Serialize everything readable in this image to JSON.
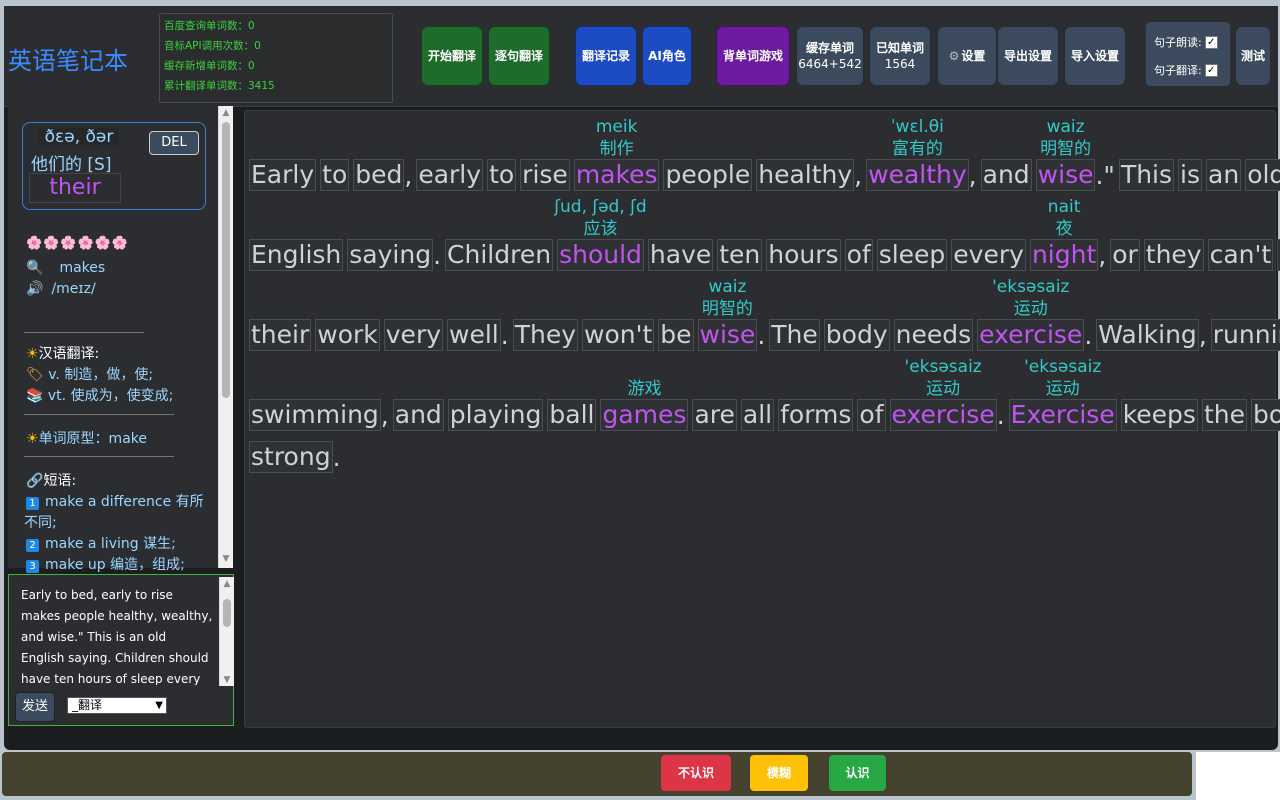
{
  "app_title": "英语笔记本",
  "stats": [
    "百度查询单词数：0",
    "音标API调用次数：0",
    "缓存新增单词数：0",
    "累计翻译单词数：3415"
  ],
  "toolbar": {
    "start_translate": "开始翻译",
    "sentence_translate": "逐句翻译",
    "history": "翻译记录",
    "ai_role": "AI角色",
    "word_game": "背单词游戏",
    "cached_label": "缓存单词",
    "cached_count": "6464+542",
    "known_label": "已知单词",
    "known_count": "1564",
    "settings": "设置",
    "export": "导出设置",
    "import": "导入设置",
    "read_sentence": "句子朗读:",
    "translate_sentence": "句子翻译:",
    "test": "测试"
  },
  "word_card": {
    "phonetic": "ðɛə, ðər",
    "meaning": "他们的 [S]",
    "word": "their",
    "delete": "DEL"
  },
  "details": {
    "rating": "🌸🌸🌸🌸🌸🌸",
    "lookup_word": "makes",
    "phonetic": "/meɪz/",
    "translation_header": "汉语翻译:",
    "def1": "v. 制造，做，使;",
    "def2": "vt. 使成为，使变成;",
    "base_form": "单词原型：make",
    "phrase_header": "短语:",
    "phrase1a": "make a difference 有所",
    "phrase1b": "不同;",
    "phrase2": "make a living 谋生;",
    "phrase3": "make up 编造，组成;"
  },
  "chat": {
    "text": "Early to bed, early to rise makes people healthy, wealthy, and wise.\" This is an old English saying. Children should have ten hours of sleep every night,",
    "send": "发送",
    "mode": "_翻译"
  },
  "passage": {
    "line1": [
      {
        "t": "Early"
      },
      {
        "t": "to"
      },
      {
        "t": "bed"
      },
      {
        "p": ","
      },
      {
        "t": "early"
      },
      {
        "t": "to"
      },
      {
        "t": "rise"
      },
      {
        "t": "makes",
        "hl": true,
        "ph": "meik",
        "cn": "制作"
      },
      {
        "t": "people"
      },
      {
        "t": "healthy"
      },
      {
        "p": ","
      },
      {
        "t": "wealthy",
        "hl": true,
        "ph": "ˈwɛl.θi",
        "cn": "富有的"
      },
      {
        "p": ","
      },
      {
        "t": "and"
      },
      {
        "t": "wise",
        "hl": true,
        "ph": "waiz",
        "cn": "明智的"
      },
      {
        "p": ".\""
      },
      {
        "t": "This"
      },
      {
        "t": "is"
      },
      {
        "t": "an"
      },
      {
        "t": "old"
      }
    ],
    "line2": [
      {
        "t": "English"
      },
      {
        "t": "saying"
      },
      {
        "p": "."
      },
      {
        "t": "Children"
      },
      {
        "t": " should ",
        "hl": true,
        "ph": "ʃud, ʃəd, ʃd",
        "cn": "应该"
      },
      {
        "t": "have"
      },
      {
        "t": "ten"
      },
      {
        "t": "hours"
      },
      {
        "t": "of"
      },
      {
        "t": "sleep"
      },
      {
        "t": "every"
      },
      {
        "t": "night",
        "hl": true,
        "ph": "nait",
        "cn": "夜"
      },
      {
        "p": ","
      },
      {
        "t": "or"
      },
      {
        "t": "they"
      },
      {
        "t": "can't"
      },
      {
        "t": "do"
      }
    ],
    "line3": [
      {
        "t": "their"
      },
      {
        "t": "work"
      },
      {
        "t": "very"
      },
      {
        "t": "well"
      },
      {
        "p": "."
      },
      {
        "t": "They"
      },
      {
        "t": "won't"
      },
      {
        "t": "be"
      },
      {
        "t": " wise ",
        "hl": true,
        "ph": "waiz",
        "cn": "明智的"
      },
      {
        "p": "."
      },
      {
        "t": "The"
      },
      {
        "t": "body"
      },
      {
        "t": "needs"
      },
      {
        "t": "exercise",
        "hl": true,
        "ph": "'eksəsaiz",
        "cn": "运动"
      },
      {
        "p": "."
      },
      {
        "t": "Walking"
      },
      {
        "p": ","
      },
      {
        "t": "running"
      },
      {
        "p": ","
      }
    ],
    "line4": [
      {
        "t": "swimming"
      },
      {
        "p": ","
      },
      {
        "t": "and"
      },
      {
        "t": "playing"
      },
      {
        "t": "ball"
      },
      {
        "t": "games",
        "hl": true,
        "ph": "",
        "cn": "游戏"
      },
      {
        "t": "are"
      },
      {
        "t": "all"
      },
      {
        "t": "forms"
      },
      {
        "t": "of"
      },
      {
        "t": "exercise",
        "hl": true,
        "ph": "'eksəsaiz",
        "cn": "运动"
      },
      {
        "p": "."
      },
      {
        "t": "Exercise",
        "hl": true,
        "ph": "'eksəsaiz",
        "cn": "运动"
      },
      {
        "t": "keeps"
      },
      {
        "t": "the"
      },
      {
        "t": "body"
      }
    ],
    "line5": [
      {
        "t": "strong"
      },
      {
        "p": "."
      }
    ]
  },
  "bottom": {
    "unknown": "不认识",
    "fuzzy": "模糊",
    "known": "认识",
    "unknown_color": "#dc3545",
    "fuzzy_color": "#ffc107",
    "known_color": "#28a745"
  }
}
